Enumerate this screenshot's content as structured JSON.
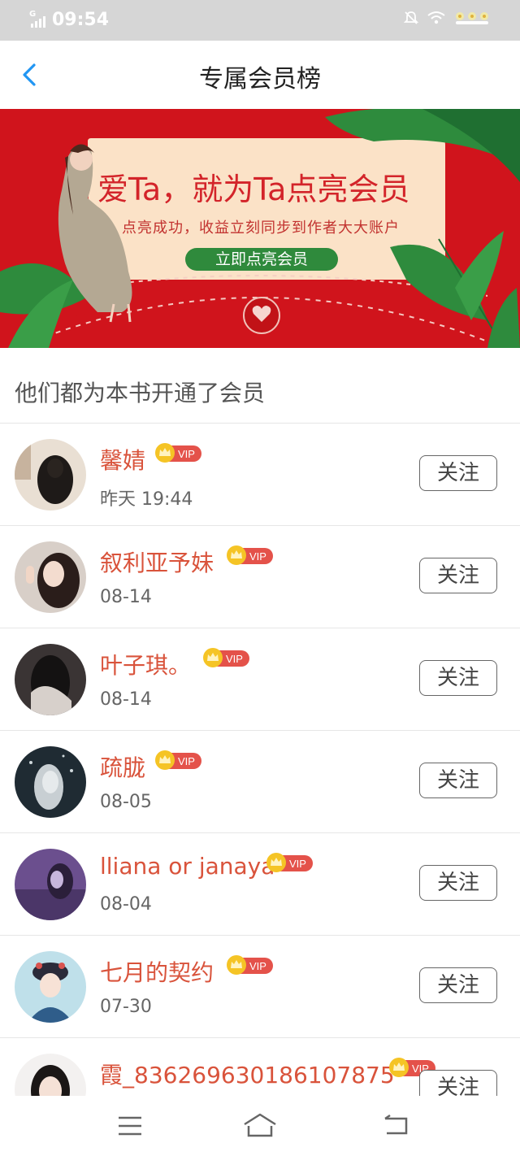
{
  "status": {
    "carrier_mark": "G",
    "time": "09:54"
  },
  "header": {
    "title": "专属会员榜"
  },
  "banner": {
    "headline": "爱Ta，就为Ta点亮会员",
    "subline": "点亮成功，收益立刻同步到作者大大账户",
    "cta_label": "立即点亮会员"
  },
  "section": {
    "title": "他们都为本书开通了会员"
  },
  "vip_label": "VIP",
  "follow_label": "关注",
  "members": [
    {
      "name": "馨婧",
      "time": "昨天 19:44"
    },
    {
      "name": "叙利亚予妹",
      "time": "08-14"
    },
    {
      "name": "叶子琪。",
      "time": "08-14"
    },
    {
      "name": "疏胧",
      "time": "08-05"
    },
    {
      "name": "lliana or janaya",
      "time": "08-04"
    },
    {
      "name": "七月的契约",
      "time": "07-30"
    },
    {
      "name": "霞_836269630186107875",
      "time": ""
    }
  ],
  "colors": {
    "accent": "#d9533b",
    "banner_red": "#d0141c",
    "cta_green": "#2f8a3c",
    "back_blue": "#2196f3"
  }
}
